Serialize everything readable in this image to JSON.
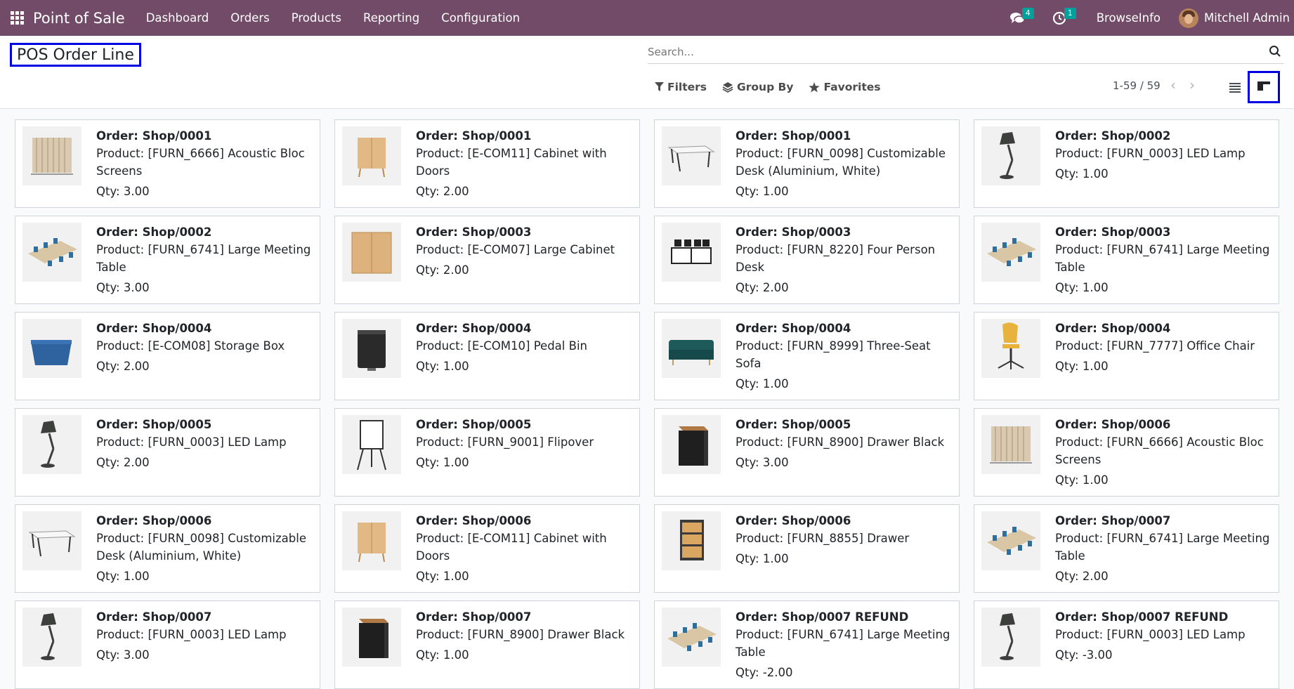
{
  "navbar": {
    "app_title": "Point of Sale",
    "menu": [
      "Dashboard",
      "Orders",
      "Products",
      "Reporting",
      "Configuration"
    ],
    "messages_count": "4",
    "activities_count": "1",
    "company": "BrowseInfo",
    "user": "Mitchell Admin",
    "color": "#714b67"
  },
  "control": {
    "title": "POS Order Line",
    "search_placeholder": "Search...",
    "filters_label": "Filters",
    "group_by_label": "Group By",
    "favorites_label": "Favorites",
    "pager": "1-59 / 59"
  },
  "cards": [
    {
      "order": "Order: Shop/0001",
      "product": "Product: [FURN_6666] Acoustic Bloc Screens",
      "qty": "Qty: 3.00",
      "img": "screens"
    },
    {
      "order": "Order: Shop/0001",
      "product": "Product: [E-COM11] Cabinet with Doors",
      "qty": "Qty: 2.00",
      "img": "cabinet-doors"
    },
    {
      "order": "Order: Shop/0001",
      "product": "Product: [FURN_0098] Customizable Desk (Aluminium, White)",
      "qty": "Qty: 1.00",
      "img": "desk"
    },
    {
      "order": "Order: Shop/0002",
      "product": "Product: [FURN_0003] LED Lamp",
      "qty": "Qty: 1.00",
      "img": "lamp"
    },
    {
      "order": "Order: Shop/0002",
      "product": "Product: [FURN_6741] Large Meeting Table",
      "qty": "Qty: 3.00",
      "img": "meeting"
    },
    {
      "order": "Order: Shop/0003",
      "product": "Product: [E-COM07] Large Cabinet",
      "qty": "Qty: 2.00",
      "img": "large-cabinet"
    },
    {
      "order": "Order: Shop/0003",
      "product": "Product: [FURN_8220] Four Person Desk",
      "qty": "Qty: 2.00",
      "img": "four-desk"
    },
    {
      "order": "Order: Shop/0003",
      "product": "Product: [FURN_6741] Large Meeting Table",
      "qty": "Qty: 1.00",
      "img": "meeting"
    },
    {
      "order": "Order: Shop/0004",
      "product": "Product: [E-COM08] Storage Box",
      "qty": "Qty: 2.00",
      "img": "storage-box"
    },
    {
      "order": "Order: Shop/0004",
      "product": "Product: [E-COM10] Pedal Bin",
      "qty": "Qty: 1.00",
      "img": "pedal-bin"
    },
    {
      "order": "Order: Shop/0004",
      "product": "Product: [FURN_8999] Three-Seat Sofa",
      "qty": "Qty: 1.00",
      "img": "sofa"
    },
    {
      "order": "Order: Shop/0004",
      "product": "Product: [FURN_7777] Office Chair",
      "qty": "Qty: 1.00",
      "img": "chair"
    },
    {
      "order": "Order: Shop/0005",
      "product": "Product: [FURN_0003] LED Lamp",
      "qty": "Qty: 2.00",
      "img": "lamp"
    },
    {
      "order": "Order: Shop/0005",
      "product": "Product: [FURN_9001] Flipover",
      "qty": "Qty: 1.00",
      "img": "flipover"
    },
    {
      "order": "Order: Shop/0005",
      "product": "Product: [FURN_8900] Drawer Black",
      "qty": "Qty: 3.00",
      "img": "drawer-black"
    },
    {
      "order": "Order: Shop/0006",
      "product": "Product: [FURN_6666] Acoustic Bloc Screens",
      "qty": "Qty: 1.00",
      "img": "screens"
    },
    {
      "order": "Order: Shop/0006",
      "product": "Product: [FURN_0098] Customizable Desk (Aluminium, White)",
      "qty": "Qty: 1.00",
      "img": "desk"
    },
    {
      "order": "Order: Shop/0006",
      "product": "Product: [E-COM11] Cabinet with Doors",
      "qty": "Qty: 1.00",
      "img": "cabinet-doors"
    },
    {
      "order": "Order: Shop/0006",
      "product": "Product: [FURN_8855] Drawer",
      "qty": "Qty: 1.00",
      "img": "drawer"
    },
    {
      "order": "Order: Shop/0007",
      "product": "Product: [FURN_6741] Large Meeting Table",
      "qty": "Qty: 2.00",
      "img": "meeting"
    },
    {
      "order": "Order: Shop/0007",
      "product": "Product: [FURN_0003] LED Lamp",
      "qty": "Qty: 3.00",
      "img": "lamp"
    },
    {
      "order": "Order: Shop/0007",
      "product": "Product: [FURN_8900] Drawer Black",
      "qty": "Qty: 1.00",
      "img": "drawer-black"
    },
    {
      "order": "Order: Shop/0007 REFUND",
      "product": "Product: [FURN_6741] Large Meeting Table",
      "qty": "Qty: -2.00",
      "img": "meeting"
    },
    {
      "order": "Order: Shop/0007 REFUND",
      "product": "Product: [FURN_0003] LED Lamp",
      "qty": "Qty: -3.00",
      "img": "lamp"
    }
  ]
}
